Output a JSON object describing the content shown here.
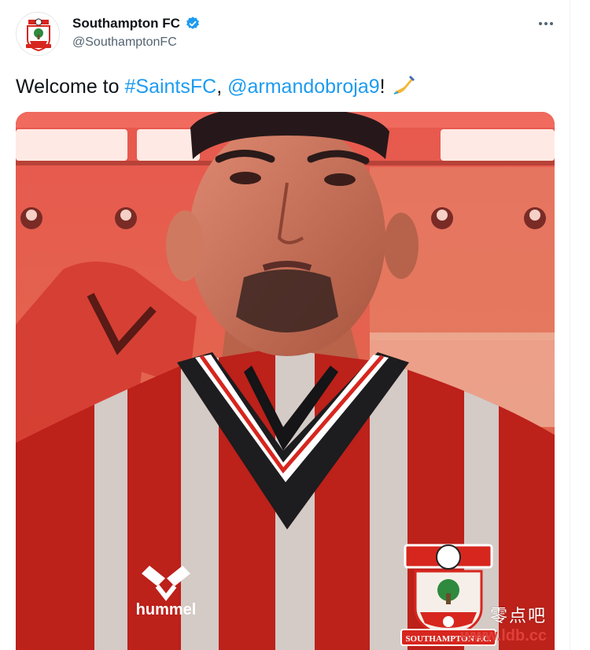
{
  "tweet": {
    "author": {
      "display_name": "Southampton FC",
      "handle": "@SouthamptonFC",
      "verified": true,
      "avatar_icon": "southampton-crest-icon"
    },
    "more_icon": "more-options-icon",
    "text": {
      "prefix": "Welcome to ",
      "hashtag": "#SaintsFC",
      "separator": ", ",
      "mention": "@armandobroja9",
      "suffix": "!",
      "emoji": "writing-hand-icon"
    },
    "media": {
      "kind": "video-still",
      "kit_brand": "hummel",
      "crest_text": "SOUTHAMPTON F.C."
    }
  },
  "watermark": {
    "cn": "零点吧",
    "url": "www.ldb.cc"
  },
  "colors": {
    "link": "#1d9bf0",
    "secondary_text": "#536471",
    "kit_red": "#d7261e"
  }
}
